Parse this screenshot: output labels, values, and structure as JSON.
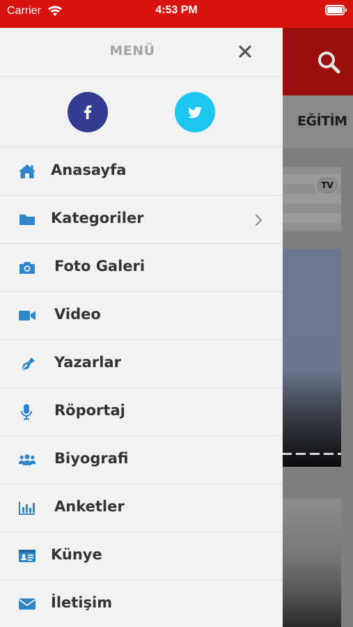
{
  "status_bar": {
    "carrier": "Carrier",
    "time": "4:53 PM"
  },
  "drawer": {
    "title": "MENÜ",
    "social": [
      {
        "name": "facebook",
        "icon": "facebook-icon",
        "color": "#343c91"
      },
      {
        "name": "twitter",
        "icon": "twitter-icon",
        "color": "#1dc6ef"
      }
    ],
    "items": [
      {
        "label": "Anasayfa",
        "icon": "home-icon"
      },
      {
        "label": "Kategoriler",
        "icon": "folder-icon",
        "has_submenu": true
      },
      {
        "label": "Foto Galeri",
        "icon": "camera-icon"
      },
      {
        "label": "Video",
        "icon": "video-camera-icon"
      },
      {
        "label": "Yazarlar",
        "icon": "pen-icon"
      },
      {
        "label": "Röportaj",
        "icon": "microphone-icon"
      },
      {
        "label": "Biyografi",
        "icon": "users-icon"
      },
      {
        "label": "Anketler",
        "icon": "bar-chart-icon"
      },
      {
        "label": "Künye",
        "icon": "id-card-icon"
      },
      {
        "label": "İletişim",
        "icon": "envelope-icon"
      }
    ]
  },
  "background": {
    "tab_label": "EĞİTİM",
    "ad_badge": "TV"
  },
  "colors": {
    "accent": "#d8120f",
    "icon_blue": "#2e86c8",
    "text": "#333333"
  }
}
